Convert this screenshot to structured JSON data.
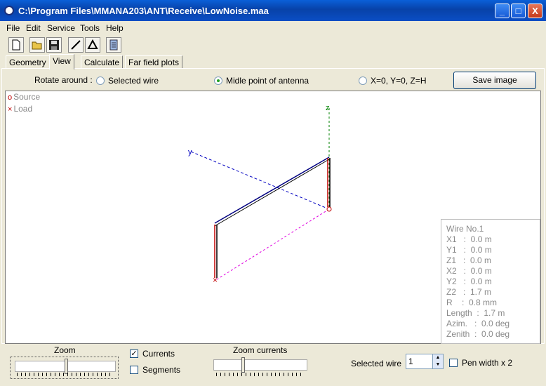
{
  "window": {
    "title": "C:\\Program Files\\MMANA203\\ANT\\Receive\\LowNoise.maa",
    "minimize": "_",
    "maximize": "□",
    "close": "X"
  },
  "menu": [
    "File",
    "Edit",
    "Service",
    "Tools",
    "Help"
  ],
  "tabs": [
    "Geometry",
    "View",
    "Calculate",
    "Far field plots"
  ],
  "active_tab": "View",
  "view": {
    "rotate_label": "Rotate around :",
    "options": [
      "Selected wire",
      "Midle point of antenna",
      "X=0, Y=0, Z=H"
    ],
    "selected_option": "Midle point of antenna",
    "save_image": "Save image"
  },
  "legend": {
    "source_marker": "o",
    "source": "Source",
    "load_marker": "×",
    "load": "Load"
  },
  "axes": {
    "x": "x",
    "y": "y",
    "z": "z"
  },
  "wire_info": {
    "title": "Wire No.1",
    "rows": [
      "X1   :  0.0 m",
      "Y1   :  0.0 m",
      "Z1   :  0.0 m",
      "X2   :  0.0 m",
      "Y2   :  0.0 m",
      "Z2   :  1.7 m",
      "R    :  0.8 mm",
      "Length  :  1.7 m",
      "Azim.   :  0.0 deg",
      "Zenith  :  0.0 deg"
    ]
  },
  "bottom": {
    "zoom": "Zoom",
    "currents": "Currents",
    "currents_checked": true,
    "segments": "Segments",
    "segments_checked": false,
    "zoom_currents": "Zoom currents",
    "selected_wire_label": "Selected wire",
    "selected_wire_value": "1",
    "pen_width": "Pen width x 2",
    "pen_width_checked": false
  },
  "colors": {
    "titlebar": "#0a4ec5",
    "wire_blue": "#000080",
    "wire_red": "#c00000",
    "axis_blue": "#0000c0",
    "axis_green": "#008000",
    "axis_magenta": "#e000e0"
  }
}
